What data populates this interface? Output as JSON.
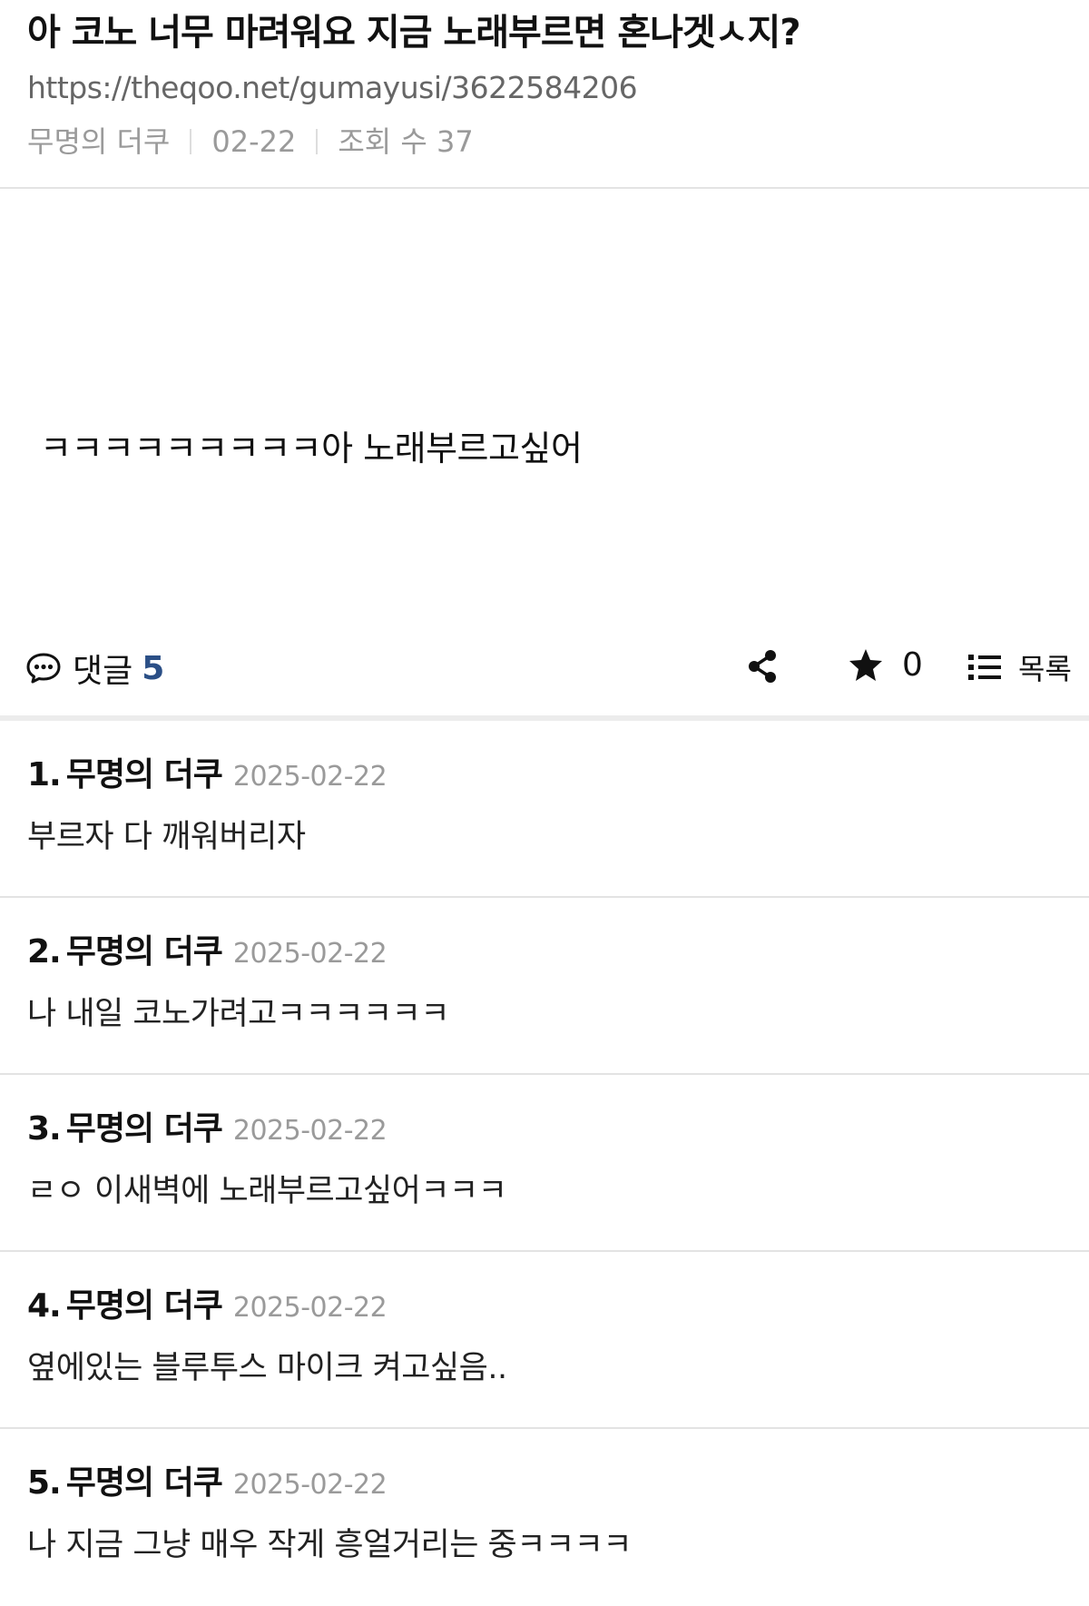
{
  "post": {
    "title": "아 코노 너무 마려워요 지금 노래부르면 혼나겟ㅅ지?",
    "url": "https://theqoo.net/gumayusi/3622584206",
    "author": "무명의 더쿠",
    "date": "02-22",
    "views_label": "조회 수 37",
    "body": "ㅋㅋㅋㅋㅋㅋㅋㅋㅋ아 노래부르고싶어"
  },
  "toolbar": {
    "comments_label": "댓글",
    "comments_count": "5",
    "share_icon": "share-icon",
    "star_icon": "star-icon",
    "star_count": "0",
    "list_icon": "list-icon",
    "list_label": "목록"
  },
  "comments": [
    {
      "num": "1.",
      "author": "무명의 더쿠",
      "date": "2025-02-22",
      "text": "부르자 다 깨워버리자"
    },
    {
      "num": "2.",
      "author": "무명의 더쿠",
      "date": "2025-02-22",
      "text": "나 내일 코노가려고ㅋㅋㅋㅋㅋㅋ"
    },
    {
      "num": "3.",
      "author": "무명의 더쿠",
      "date": "2025-02-22",
      "text": "ㄹㅇ 이새벽에 노래부르고싶어ㅋㅋㅋ"
    },
    {
      "num": "4.",
      "author": "무명의 더쿠",
      "date": "2025-02-22",
      "text": "옆에있는 블루투스 마이크 켜고싶음.."
    },
    {
      "num": "5.",
      "author": "무명의 더쿠",
      "date": "2025-02-22",
      "text": "나 지금 그냥 매우 작게 흥얼거리는 중ㅋㅋㅋㅋ"
    }
  ],
  "colors": {
    "accent": "#2b4f86",
    "muted": "#9a9a9a",
    "divider": "#e3e3e3"
  }
}
